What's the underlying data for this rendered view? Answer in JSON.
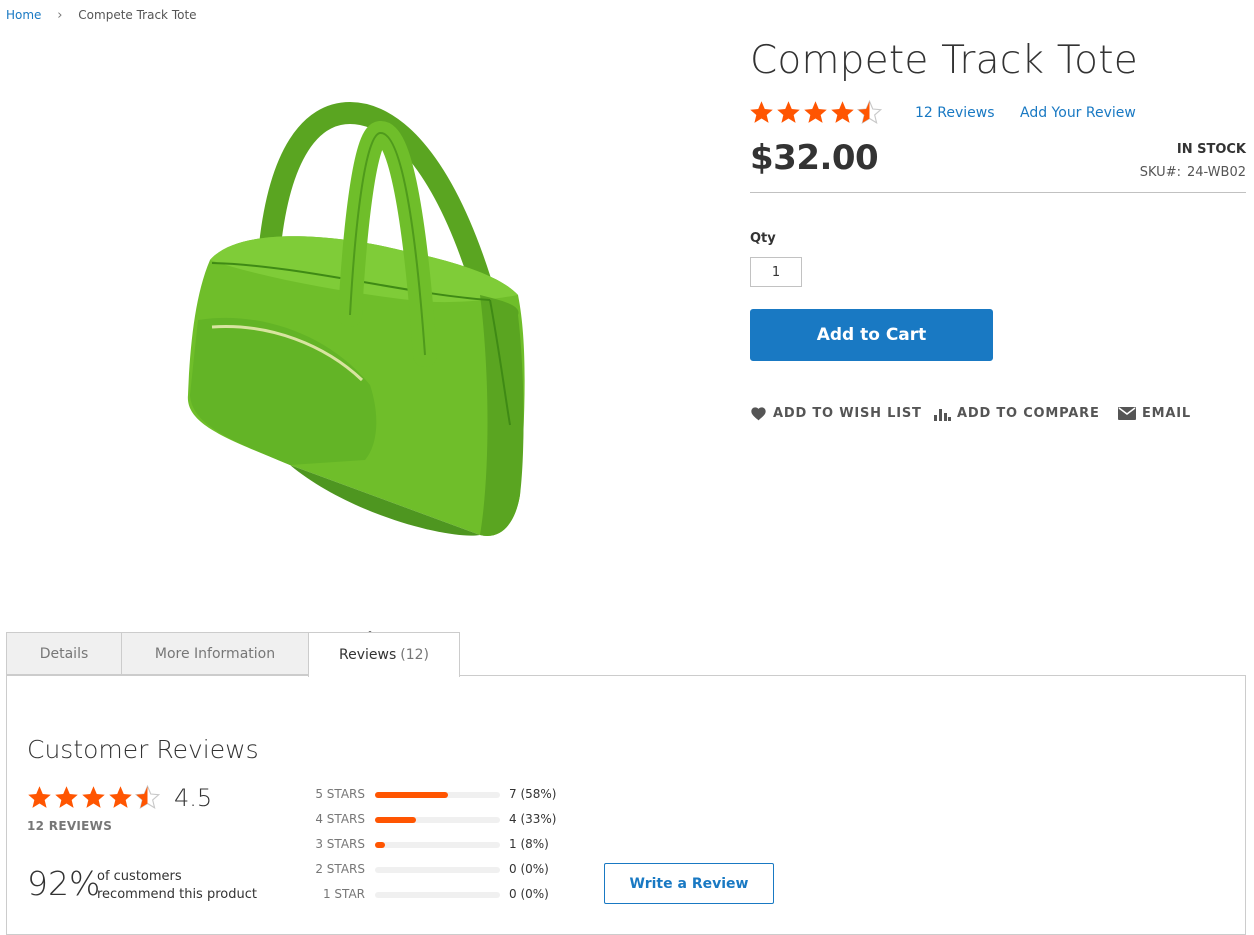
{
  "breadcrumb": {
    "home": "Home",
    "current": "Compete Track Tote"
  },
  "product": {
    "title": "Compete Track Tote",
    "rating": 4.5,
    "reviews_link": "12 Reviews",
    "add_review_link": "Add Your Review",
    "price": "$32.00",
    "stock": "IN STOCK",
    "sku_label": "SKU#:",
    "sku": "24-WB02",
    "color": "#6fbe2a"
  },
  "qty": {
    "label": "Qty",
    "value": "1"
  },
  "add_to_cart": {
    "label": "Add to Cart",
    "color": "#1979c3"
  },
  "actions": [
    {
      "label": "ADD TO WISH LIST",
      "icon": "heart-icon"
    },
    {
      "label": "ADD TO COMPARE",
      "icon": "compare-bars-icon"
    },
    {
      "label": "EMAIL",
      "icon": "envelope-icon"
    }
  ],
  "tabs": [
    {
      "label": "Details",
      "active": false
    },
    {
      "label": "More Information",
      "active": false
    },
    {
      "label": "Reviews",
      "count": "(12)",
      "active": true
    }
  ],
  "reviews": {
    "title": "Customer Reviews",
    "average": "4.5",
    "average_stars": 4.5,
    "total": "12 REVIEWS",
    "recommend_pct": "92%",
    "recommend_line1": "of customers",
    "recommend_line2": "recommend this product",
    "histogram": [
      {
        "label": "5 STARS",
        "count": "7 (58%)",
        "fraction": 0.58
      },
      {
        "label": "4 STARS",
        "count": "4 (33%)",
        "fraction": 0.33
      },
      {
        "label": "3 STARS",
        "count": "1 (8%)",
        "fraction": 0.08
      },
      {
        "label": "2 STARS",
        "count": "0 (0%)",
        "fraction": 0
      },
      {
        "label": "1 STAR",
        "count": "0 (0%)",
        "fraction": 0
      }
    ],
    "write_review": "Write a Review"
  },
  "colors": {
    "star": "#ff5501",
    "link": "#1979c3",
    "bar": "#ff5501"
  }
}
